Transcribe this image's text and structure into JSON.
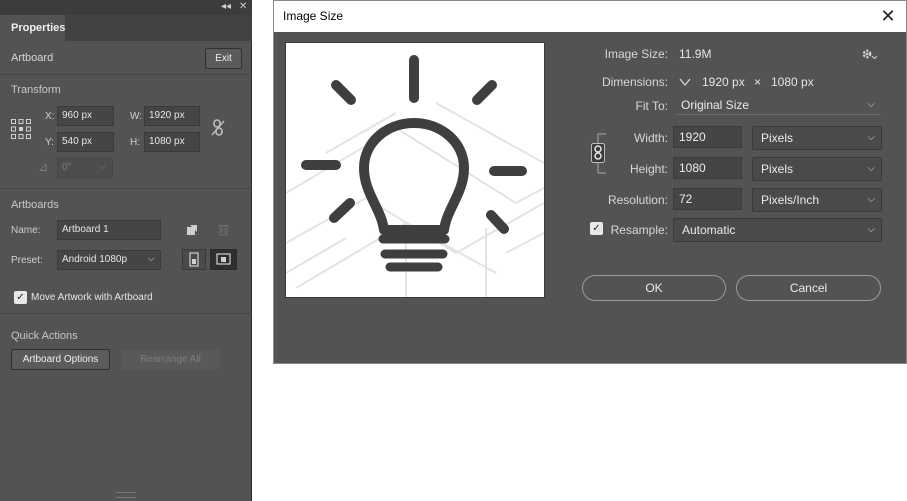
{
  "properties": {
    "panel_controls": {
      "collapse": "◂◂",
      "close": "✕"
    },
    "tab": "Properties",
    "artboard_label": "Artboard",
    "exit_label": "Exit",
    "transform": {
      "title": "Transform",
      "x_label": "X:",
      "x_value": "960 px",
      "y_label": "Y:",
      "y_value": "540 px",
      "w_label": "W:",
      "w_value": "1920 px",
      "h_label": "H:",
      "h_value": "1080 px",
      "angle_value": "0°"
    },
    "artboards": {
      "title": "Artboards",
      "name_label": "Name:",
      "name_value": "Artboard 1",
      "preset_label": "Preset:",
      "preset_value": "Android 1080p",
      "move_artwork_label": "Move Artwork with Artboard"
    },
    "quick_actions": {
      "title": "Quick Actions",
      "artboard_options_label": "Artboard Options",
      "rearrange_all_label": "Rearrange All"
    }
  },
  "dialog": {
    "title": "Image Size",
    "close": "✕",
    "image_size_label": "Image Size:",
    "image_size_value": "11.9M",
    "dimensions_label": "Dimensions:",
    "dimensions_width": "1920 px",
    "dimensions_times": "×",
    "dimensions_height": "1080 px",
    "fit_to_label": "Fit To:",
    "fit_to_value": "Original Size",
    "width_label": "Width:",
    "width_value": "1920",
    "width_unit": "Pixels",
    "height_label": "Height:",
    "height_value": "1080",
    "height_unit": "Pixels",
    "resolution_label": "Resolution:",
    "resolution_value": "72",
    "resolution_unit": "Pixels/Inch",
    "resample_label": "Resample:",
    "resample_value": "Automatic",
    "ok_label": "OK",
    "cancel_label": "Cancel"
  },
  "colors": {
    "panel_bg": "#535353",
    "field_bg": "#454545",
    "accent_dark": "#2e2e2e",
    "title_bar": "#ffffff"
  }
}
